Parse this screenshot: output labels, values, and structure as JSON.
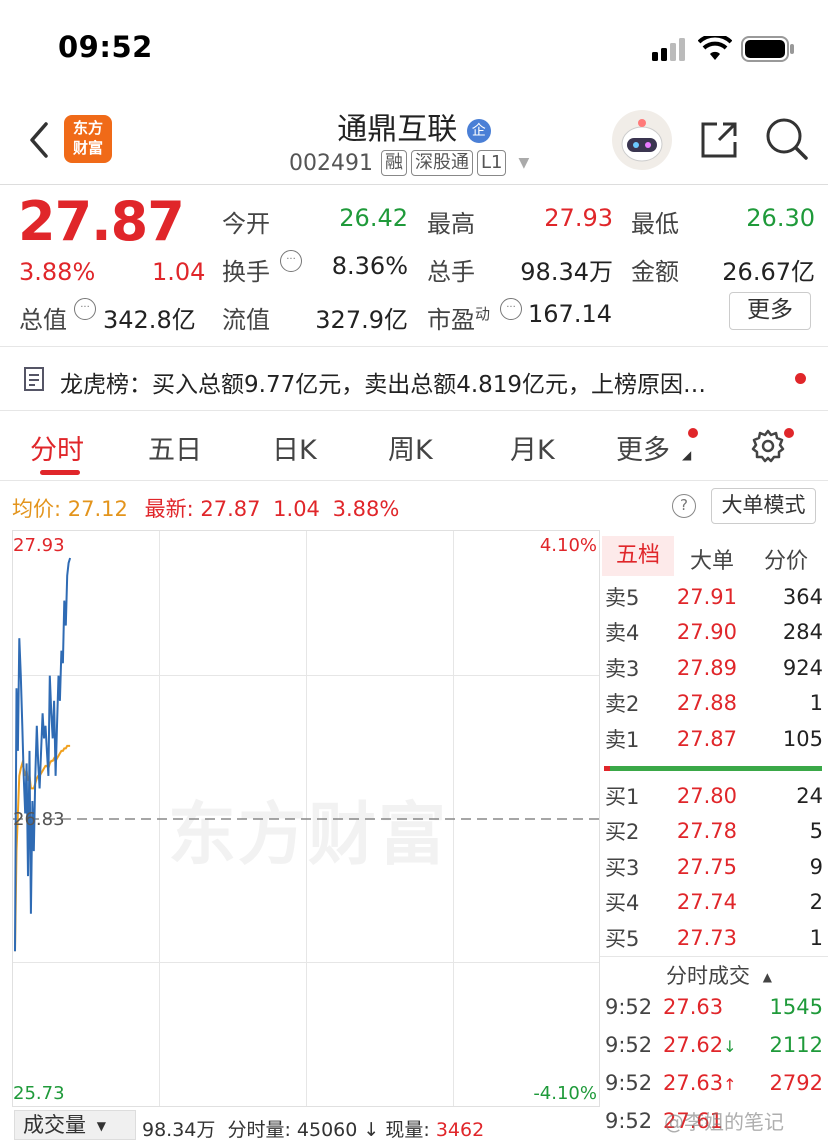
{
  "status_bar": {
    "time": "09:52"
  },
  "header": {
    "logo_text_1": "东方",
    "logo_text_2": "财富",
    "title": "通鼎互联",
    "title_badge": "企",
    "code": "002491",
    "tags": [
      "融",
      "深股通",
      "L1"
    ]
  },
  "quote": {
    "price": "27.87",
    "change_pct": "3.88%",
    "change": "1.04",
    "market_value_label": "总值",
    "market_value": "342.8亿",
    "fields": [
      {
        "label": "今开",
        "value": "26.42",
        "color": "green"
      },
      {
        "label": "最高",
        "value": "27.93",
        "color": "red"
      },
      {
        "label": "最低",
        "value": "26.30",
        "color": "green"
      },
      {
        "label": "换手",
        "value": "8.36%",
        "color": "dark"
      },
      {
        "label": "总手",
        "value": "98.34万",
        "color": "dark"
      },
      {
        "label": "金额",
        "value": "26.67亿",
        "color": "dark"
      },
      {
        "label": "流值",
        "value": "327.9亿",
        "color": "dark"
      },
      {
        "label": "市盈",
        "label_sup": "动",
        "value": "167.14",
        "color": "dark"
      }
    ],
    "more_button": "更多"
  },
  "notice": {
    "text": "龙虎榜：买入总额9.77亿元，卖出总额4.819亿元，上榜原因…"
  },
  "tabs": [
    "分时",
    "五日",
    "日K",
    "周K",
    "月K",
    "更多"
  ],
  "chart_info": {
    "avg_label": "均价:",
    "avg_value": "27.12",
    "latest_label": "最新:",
    "latest_value": "27.87",
    "latest_change": "1.04",
    "latest_pct": "3.88%",
    "help_icon": "?",
    "big_order_button": "大单模式"
  },
  "chart_data": {
    "type": "line",
    "ylim": [
      25.73,
      27.93
    ],
    "y_top_label": "27.93",
    "y_mid_label": "26.83",
    "y_bottom_label": "25.73",
    "pct_top_label": "4.10%",
    "pct_bottom_label": "-4.10%",
    "watermark": "东方财富",
    "series": [
      {
        "name": "price",
        "color": "#2f6bb4",
        "x": [
          0,
          1,
          2,
          3,
          4,
          5,
          6,
          7,
          8,
          9,
          10,
          11,
          12,
          13,
          14,
          15,
          16,
          17,
          18,
          19,
          20,
          21,
          22,
          23,
          24,
          25,
          26,
          27,
          28,
          29,
          30,
          31,
          32,
          33,
          34,
          35,
          36,
          37,
          38
        ],
        "values": [
          26.3,
          27.35,
          27.1,
          27.55,
          27.4,
          27.2,
          27.0,
          26.85,
          27.05,
          26.6,
          27.1,
          26.45,
          26.9,
          26.7,
          27.0,
          27.2,
          27.05,
          26.95,
          27.1,
          27.25,
          27.15,
          27.2,
          27.1,
          27.0,
          27.4,
          27.25,
          27.15,
          27.3,
          27.0,
          27.2,
          27.4,
          27.3,
          27.5,
          27.45,
          27.7,
          27.6,
          27.8,
          27.85,
          27.87
        ]
      },
      {
        "name": "avg",
        "color": "#f0a01e",
        "x": [
          0,
          1,
          2,
          3,
          4,
          5,
          6,
          7,
          8,
          9,
          10,
          11,
          12,
          13,
          14,
          15,
          16,
          17,
          18,
          19,
          20,
          21,
          22,
          23,
          24,
          25,
          26,
          27,
          28,
          29,
          30,
          31,
          32,
          33,
          34,
          35,
          36,
          37,
          38
        ],
        "values": [
          26.3,
          26.7,
          26.85,
          27.0,
          27.03,
          27.05,
          27.03,
          27.0,
          27.02,
          26.98,
          27.0,
          26.95,
          26.95,
          26.95,
          26.97,
          26.99,
          27.0,
          27.0,
          27.01,
          27.02,
          27.03,
          27.04,
          27.04,
          27.03,
          27.05,
          27.06,
          27.06,
          27.07,
          27.06,
          27.07,
          27.08,
          27.09,
          27.1,
          27.1,
          27.11,
          27.11,
          27.12,
          27.12,
          27.12
        ]
      }
    ]
  },
  "orderbook": {
    "tabs": [
      "五档",
      "大单",
      "分价"
    ],
    "asks": [
      {
        "label": "卖5",
        "price": "27.91",
        "volume": "364"
      },
      {
        "label": "卖4",
        "price": "27.90",
        "volume": "284"
      },
      {
        "label": "卖3",
        "price": "27.89",
        "volume": "924"
      },
      {
        "label": "卖2",
        "price": "27.88",
        "volume": "1"
      },
      {
        "label": "卖1",
        "price": "27.87",
        "volume": "105"
      }
    ],
    "bids": [
      {
        "label": "买1",
        "price": "27.80",
        "volume": "24"
      },
      {
        "label": "买2",
        "price": "27.78",
        "volume": "5"
      },
      {
        "label": "买3",
        "price": "27.75",
        "volume": "9"
      },
      {
        "label": "买4",
        "price": "27.74",
        "volume": "2"
      },
      {
        "label": "买5",
        "price": "27.73",
        "volume": "1"
      }
    ],
    "trades_title": "分时成交",
    "trades": [
      {
        "time": "9:52",
        "price": "27.63",
        "arrow": "",
        "volume": "1545",
        "color": "green"
      },
      {
        "time": "9:52",
        "price": "27.62",
        "arrow": "↓",
        "volume": "2112",
        "color": "green"
      },
      {
        "time": "9:52",
        "price": "27.63",
        "arrow": "↑",
        "volume": "2792",
        "color": "red"
      },
      {
        "time": "9:52",
        "price": "27.61",
        "arrow": "",
        "volume": "",
        "color": "red"
      }
    ]
  },
  "volume_bar": {
    "selector": "成交量",
    "total": "98.34万",
    "intraday_label": "分时量:",
    "intraday_value": "45060",
    "arrow": "↓",
    "current_label": "现量:",
    "current_value": "3462"
  },
  "watermark_bottom": "@李姐的笔记"
}
